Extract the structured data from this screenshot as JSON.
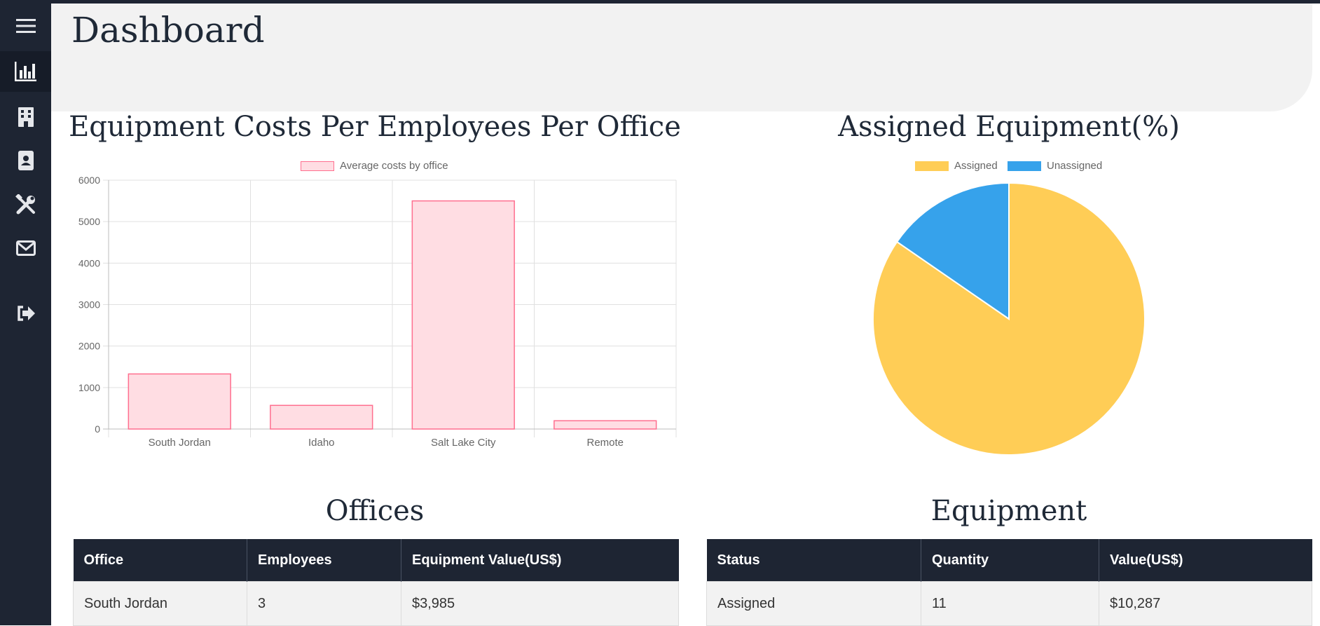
{
  "header": {
    "title": "Dashboard"
  },
  "sidebar": {
    "items": [
      {
        "icon": "menu-icon"
      },
      {
        "icon": "chart-bar-icon"
      },
      {
        "icon": "building-icon"
      },
      {
        "icon": "contact-card-icon"
      },
      {
        "icon": "tools-icon"
      },
      {
        "icon": "envelope-icon"
      },
      {
        "icon": "sign-out-icon"
      }
    ]
  },
  "bar_section": {
    "title": "Equipment Costs Per Employees Per Office"
  },
  "pie_section": {
    "title": "Assigned Equipment(%)"
  },
  "chart_data": [
    {
      "type": "bar",
      "categories": [
        "South Jordan",
        "Idaho",
        "Salt Lake City",
        "Remote"
      ],
      "series": [
        {
          "name": "Average costs by office",
          "values": [
            1328,
            570,
            5500,
            200
          ],
          "fill": "#ffdde3",
          "stroke": "#ff6f8f"
        }
      ],
      "ylim": [
        0,
        6000
      ],
      "yticks": [
        "0",
        "1000",
        "2000",
        "3000",
        "4000",
        "5000",
        "6000"
      ],
      "grid": true,
      "legend": "top-center"
    },
    {
      "type": "pie",
      "labels": [
        "Assigned",
        "Unassigned"
      ],
      "values": [
        84.6,
        15.4
      ],
      "colors": [
        "#ffcd56",
        "#36a2eb"
      ],
      "legend": "top-center"
    }
  ],
  "offices_section": {
    "title": "Offices",
    "columns": [
      "Office",
      "Employees",
      "Equipment Value(US$)"
    ],
    "rows": [
      [
        "South Jordan",
        "3",
        "$3,985"
      ]
    ]
  },
  "equipment_section": {
    "title": "Equipment",
    "columns": [
      "Status",
      "Quantity",
      "Value(US$)"
    ],
    "rows": [
      [
        "Assigned",
        "11",
        "$10,287"
      ]
    ]
  }
}
